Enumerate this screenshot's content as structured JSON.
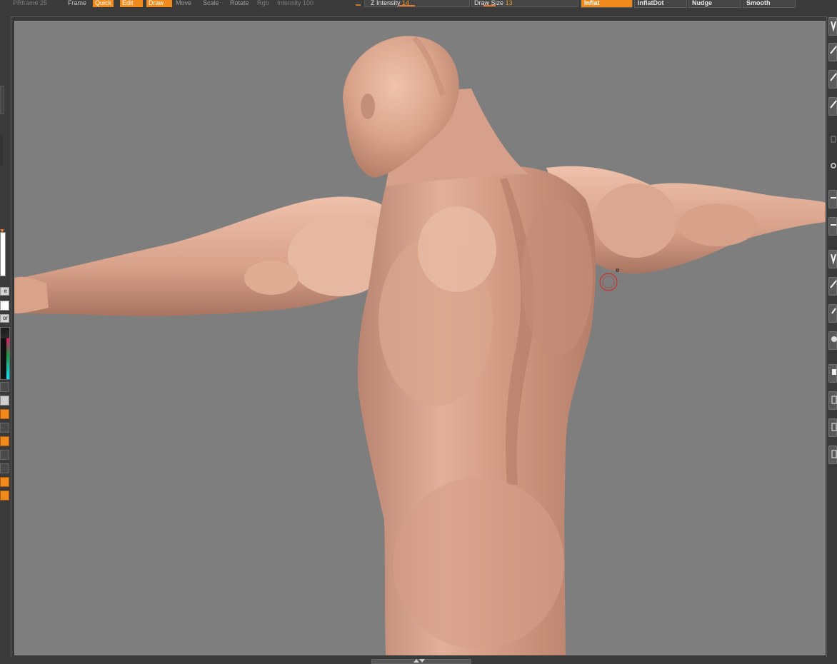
{
  "toolbar": {
    "prframe_label": "PRframe",
    "prframe_value": "25",
    "frame_label": "Frame",
    "quick_label": "Quick",
    "edit_label": "Edit",
    "draw_label": "Draw",
    "move_label": "Move",
    "scale_label": "Scale",
    "rotate_label": "Rotate",
    "rgb_label": "Rgb",
    "rgb_intensity_label": "Intensity",
    "rgb_intensity_value": "100",
    "z_intensity_label": "Z Intensity",
    "z_intensity_value": "14",
    "draw_size_label": "Draw",
    "draw_size_label2": "Size",
    "draw_size_value": "13"
  },
  "brushes": {
    "items": [
      {
        "label": "Inflat",
        "active": true
      },
      {
        "label": "InflatDot",
        "active": false
      },
      {
        "label": "Nudge",
        "active": false
      },
      {
        "label": "Smooth",
        "active": false
      }
    ]
  },
  "left_panel": {
    "btn_e": "e",
    "btn_or": "or"
  },
  "colors": {
    "accent": "#f08a1c",
    "canvas_bg": "#7e7e7e",
    "ui_bg": "#3a3a3a",
    "brush_cursor": "#c8312b",
    "skin": "#d9a38a"
  }
}
